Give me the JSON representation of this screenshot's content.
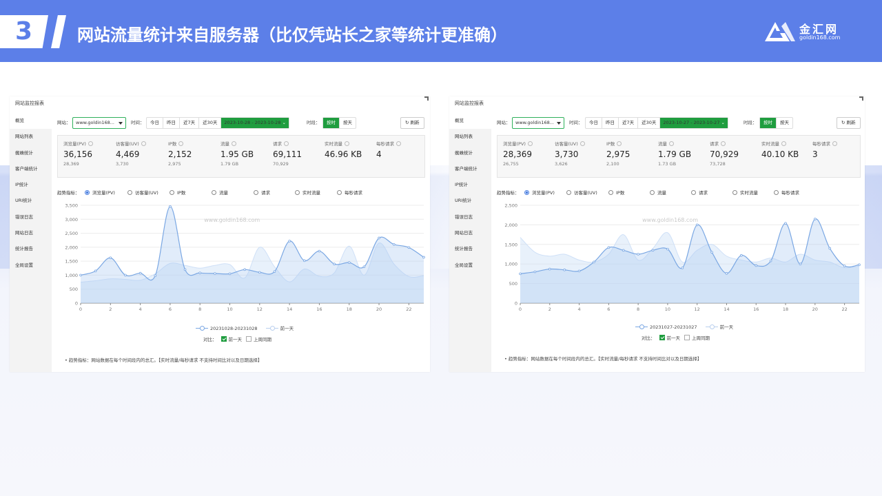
{
  "header": {
    "number": "3",
    "title": "网站流量统计来自服务器（比仅凭站长之家等统计更准确）"
  },
  "logo": {
    "cn": "金汇网",
    "en": "goldin168.com"
  },
  "colors": {
    "accent": "#5c7fe8",
    "green": "#1f9d3f",
    "series_current": "#7aa7e3",
    "series_prev": "#cfe0f7"
  },
  "panels": [
    {
      "title": "网站监控报表",
      "sidebar": [
        "概览",
        "网站列表",
        "蜘蛛统计",
        "客户端统计",
        "IP统计",
        "URI统计",
        "错误日志",
        "网站日志",
        "统计报告",
        "全局设置"
      ],
      "site_label": "网站：",
      "site_value": "www.goldin168...",
      "time_label": "时间：",
      "time_buttons": [
        "今日",
        "昨日",
        "近7天",
        "近30天"
      ],
      "date_range": "2023-10-28 - 2023-10-28",
      "period_label": "时段：",
      "period_buttons": [
        "按时",
        "按天"
      ],
      "refresh": "刷新",
      "stats": [
        {
          "label": "浏览量(PV)",
          "value": "36,156",
          "sub": "28,369"
        },
        {
          "label": "访客量(UV)",
          "value": "4,469",
          "sub": "3,730"
        },
        {
          "label": "IP数",
          "value": "2,152",
          "sub": "2,975"
        },
        {
          "label": "流量",
          "value": "1.95 GB",
          "sub": "1.79 GB"
        },
        {
          "label": "请求",
          "value": "69,111",
          "sub": "70,929"
        },
        {
          "label": "实时流量",
          "value": "46.96 KB",
          "sub": ""
        },
        {
          "label": "每秒请求",
          "value": "4",
          "sub": ""
        }
      ],
      "metrics_label": "趋势指标：",
      "metrics": [
        "浏览量(PV)",
        "访客量(UV)",
        "IP数",
        "流量",
        "请求",
        "实时流量",
        "每秒请求"
      ],
      "watermark": "www.goldin168.com",
      "legend": [
        "20231028-20231028",
        "前一天"
      ],
      "compare_label": "对比：",
      "compare_options": [
        "前一天",
        "上周同期"
      ],
      "note": "• 趋势指标：网站数据在每个时间段内的总汇。【实时流量/每秒请求 不支持时间比对以及日期选择】"
    },
    {
      "title": "网站监控报表",
      "sidebar": [
        "概览",
        "网站列表",
        "蜘蛛统计",
        "客户端统计",
        "IP统计",
        "URI统计",
        "错误日志",
        "网站日志",
        "统计报告",
        "全局设置"
      ],
      "site_label": "网站：",
      "site_value": "www.goldin168...",
      "time_label": "时间：",
      "time_buttons": [
        "今日",
        "昨日",
        "近7天",
        "近30天"
      ],
      "date_range": "2023-10-27 - 2023-10-27",
      "period_label": "时段：",
      "period_buttons": [
        "按时",
        "按天"
      ],
      "refresh": "刷新",
      "stats": [
        {
          "label": "浏览量(PV)",
          "value": "28,369",
          "sub": "26,755"
        },
        {
          "label": "访客量(UV)",
          "value": "3,730",
          "sub": "3,626"
        },
        {
          "label": "IP数",
          "value": "2,975",
          "sub": "2,100"
        },
        {
          "label": "流量",
          "value": "1.79 GB",
          "sub": "1.73 GB"
        },
        {
          "label": "请求",
          "value": "70,929",
          "sub": "73,728"
        },
        {
          "label": "实时流量",
          "value": "40.10 KB",
          "sub": ""
        },
        {
          "label": "每秒请求",
          "value": "3",
          "sub": ""
        }
      ],
      "metrics_label": "趋势指标：",
      "metrics": [
        "浏览量(PV)",
        "访客量(UV)",
        "IP数",
        "流量",
        "请求",
        "实时流量",
        "每秒请求"
      ],
      "watermark": "www.goldin168.com",
      "legend": [
        "20231027-20231027",
        "前一天"
      ],
      "compare_label": "对比：",
      "compare_options": [
        "前一天",
        "上周同期"
      ],
      "note": "• 趋势指标：网站数据在每个时间段内的总汇。【实时流量/每秒请求 不支持时间比对以及日期选择】"
    }
  ],
  "chart_data": [
    {
      "type": "area",
      "x": [
        0,
        1,
        2,
        3,
        4,
        5,
        6,
        7,
        8,
        9,
        10,
        11,
        12,
        13,
        14,
        15,
        16,
        17,
        18,
        19,
        20,
        21,
        22,
        23
      ],
      "xticks": [
        "0",
        "2",
        "4",
        "6",
        "8",
        "10",
        "12",
        "14",
        "16",
        "18",
        "20",
        "22"
      ],
      "yticks": [
        "0",
        "500",
        "1,000",
        "1,500",
        "2,000",
        "2,500",
        "3,000",
        "3,500"
      ],
      "ylim": [
        0,
        3500
      ],
      "series": [
        {
          "name": "20231028-20231028",
          "values": [
            1000,
            1150,
            1620,
            1000,
            1070,
            980,
            3460,
            1200,
            1080,
            1060,
            1050,
            1200,
            1100,
            1130,
            2220,
            1520,
            1860,
            1400,
            1450,
            1300,
            2330,
            2100,
            1990,
            1640
          ]
        },
        {
          "name": "前一天",
          "values": [
            750,
            800,
            870,
            850,
            820,
            1050,
            1420,
            1350,
            1250,
            1350,
            1380,
            900,
            2000,
            1300,
            760,
            1220,
            960,
            1080,
            2040,
            1000,
            2150,
            1400,
            950,
            980
          ]
        }
      ]
    },
    {
      "type": "area",
      "x": [
        0,
        1,
        2,
        3,
        4,
        5,
        6,
        7,
        8,
        9,
        10,
        11,
        12,
        13,
        14,
        15,
        16,
        17,
        18,
        19,
        20,
        21,
        22,
        23
      ],
      "xticks": [
        "0",
        "2",
        "4",
        "6",
        "8",
        "10",
        "12",
        "14",
        "16",
        "18",
        "20",
        "22"
      ],
      "yticks": [
        "0",
        "500",
        "1,000",
        "1,500",
        "2,000",
        "2,500"
      ],
      "ylim": [
        0,
        2500
      ],
      "series": [
        {
          "name": "20231027-20231027",
          "values": [
            750,
            800,
            870,
            850,
            820,
            1050,
            1420,
            1350,
            1250,
            1350,
            1380,
            900,
            2000,
            1300,
            760,
            1220,
            960,
            1080,
            2040,
            1000,
            2150,
            1400,
            950,
            980
          ]
        },
        {
          "name": "前一天",
          "values": [
            1680,
            1300,
            1200,
            1250,
            1100,
            1050,
            1250,
            1750,
            1100,
            1400,
            1800,
            1050,
            1350,
            1500,
            1200,
            1100,
            1050,
            1150,
            1050,
            1250,
            1100,
            1050,
            900,
            950
          ]
        }
      ]
    }
  ]
}
